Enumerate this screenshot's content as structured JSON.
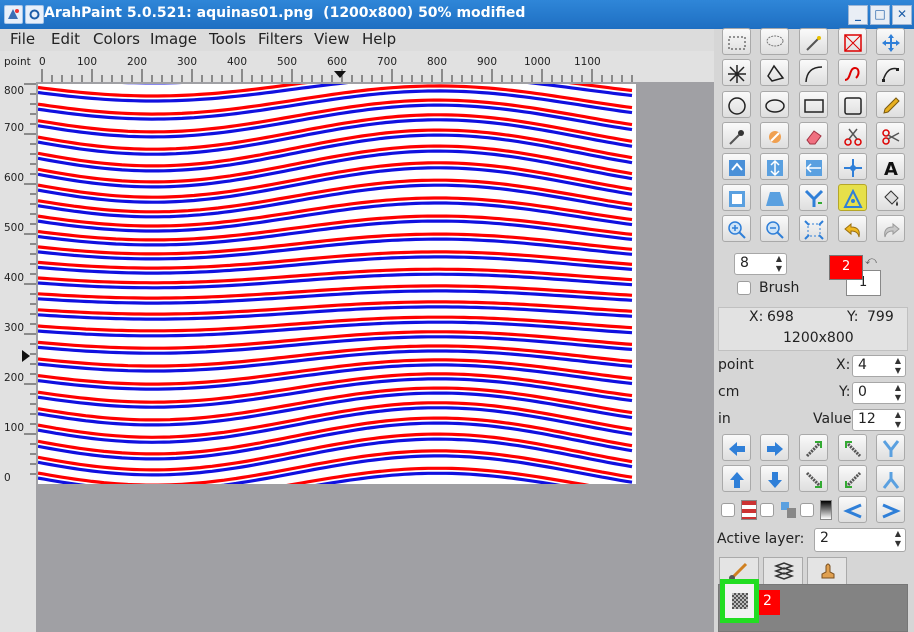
{
  "window": {
    "title": "ArahPaint 5.0.521: aquinas01.png  (1200x800) 50% modified",
    "buttons": [
      "_",
      "□",
      "✕"
    ]
  },
  "menu": [
    "File",
    "Edit",
    "Colors",
    "Image",
    "Tools",
    "Filters",
    "View",
    "Help"
  ],
  "ruler": {
    "unit": "point",
    "h_labels": [
      "0",
      "100",
      "200",
      "300",
      "400",
      "500",
      "600",
      "700",
      "800",
      "900",
      "1000",
      "1100"
    ],
    "v_labels": [
      "800",
      "700",
      "600",
      "500",
      "400",
      "300",
      "200",
      "100",
      "0"
    ]
  },
  "canvas": {
    "pattern_colors": {
      "red": "#ff0000",
      "blue": "#1010e0",
      "background": "#ffffff"
    }
  },
  "brush": {
    "size": "8",
    "label": "Brush",
    "checked": false
  },
  "colors": {
    "primary_label": "2",
    "secondary_label": "1",
    "primary_color": "#ff0000",
    "secondary_color": "#ffffff"
  },
  "info": {
    "x_label": "X:",
    "x_value": "698",
    "y_label": "Y:",
    "y_value": "799",
    "size": "1200x800"
  },
  "units": {
    "point": "point",
    "cm": "cm",
    "in": "in"
  },
  "params": {
    "x_label": "X:",
    "x_value": "4",
    "y_label": "Y:",
    "y_value": "0",
    "value_label": "Value",
    "value": "12"
  },
  "layer": {
    "label": "Active layer:",
    "value": "2",
    "item_label": "2",
    "item_color": "#ff0000"
  }
}
